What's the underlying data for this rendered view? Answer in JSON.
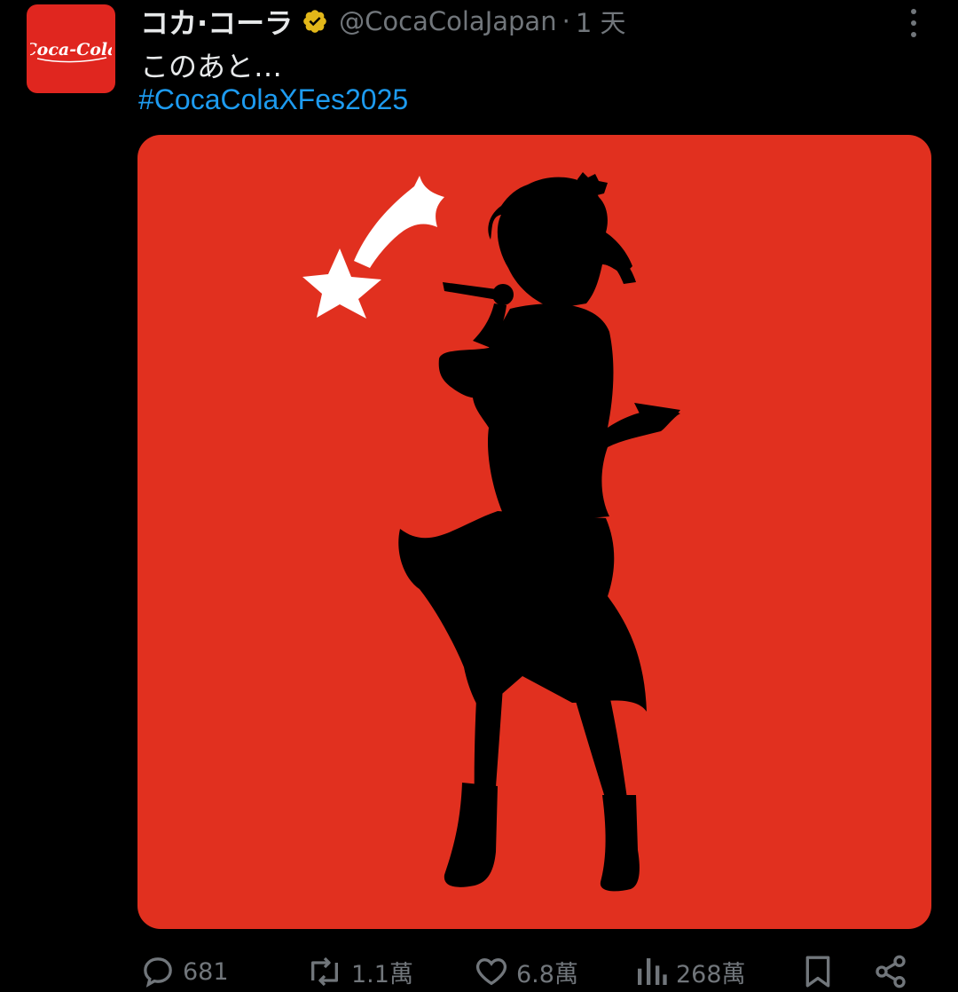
{
  "post": {
    "avatar_logo_text": "Coca-Cola",
    "display_name": "コカ·コーラ",
    "verified_icon": "verified-badge-gold",
    "handle": "@CocaColaJapan",
    "separator": "·",
    "timestamp": "1 天",
    "text": "このあと…",
    "hashtag": "#CocaColaXFes2025",
    "media": {
      "background_color": "#e1301f",
      "description_icon": "silhouette-performer-with-shooting-star"
    }
  },
  "actions": {
    "reply": {
      "icon": "reply-icon",
      "count": "681"
    },
    "repost": {
      "icon": "repost-icon",
      "count": "1.1萬"
    },
    "like": {
      "icon": "heart-icon",
      "count": "6.8萬"
    },
    "views": {
      "icon": "views-icon",
      "count": "268萬"
    },
    "bookmark": {
      "icon": "bookmark-icon"
    },
    "share": {
      "icon": "share-icon"
    }
  },
  "colors": {
    "background": "#000000",
    "text_primary": "#e7e9ea",
    "text_secondary": "#71767b",
    "link": "#1d9bf0",
    "brand_red": "#e0261f",
    "verified_gold": "#e2b719"
  }
}
